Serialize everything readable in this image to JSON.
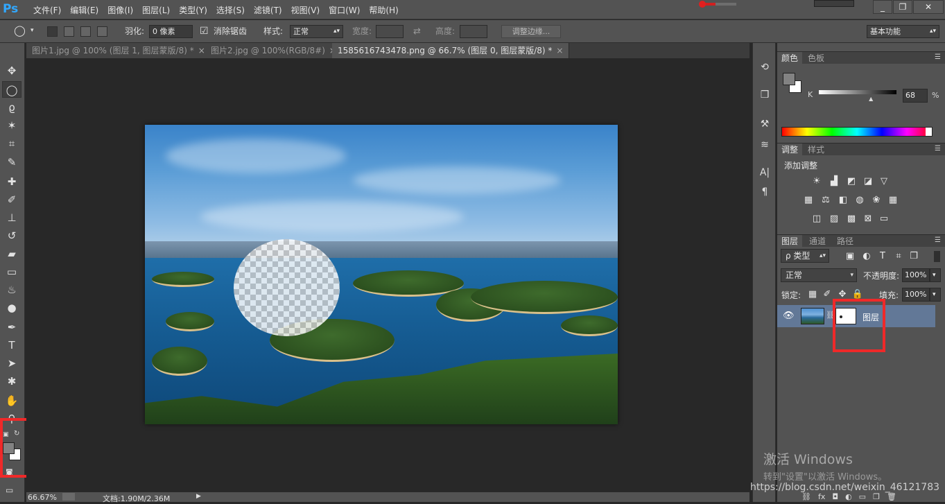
{
  "app": {
    "logo": "Ps"
  },
  "menu": [
    "文件(F)",
    "编辑(E)",
    "图像(I)",
    "图层(L)",
    "类型(Y)",
    "选择(S)",
    "滤镜(T)",
    "视图(V)",
    "窗口(W)",
    "帮助(H)"
  ],
  "window_buttons": [
    "_",
    "❐",
    "✕"
  ],
  "options": {
    "feather_label": "羽化:",
    "feather_value": "0 像素",
    "antialias_label": "消除锯齿",
    "style_label": "样式:",
    "style_value": "正常",
    "width_label": "宽度:",
    "height_label": "高度:",
    "refine_edge": "调整边缘...",
    "workspace": "基本功能"
  },
  "tabs": [
    {
      "label": "图片1.jpg @ 100% (图层 1, 图层蒙版/8) *"
    },
    {
      "label": "图片2.jpg @ 100%(RGB/8#)"
    },
    {
      "label": "1585616743478.png @ 66.7% (图层 0, 图层蒙版/8) *"
    }
  ],
  "status": {
    "zoom": "66.67%",
    "doc": "文档:1.90M/2.36M"
  },
  "color_panel": {
    "tabs": [
      "颜色",
      "色板"
    ],
    "channel": "K",
    "value": "68",
    "unit": "%",
    "slider_level": 0.68
  },
  "adjust_panel": {
    "tabs": [
      "调整",
      "样式"
    ],
    "title": "添加调整"
  },
  "layers_panel": {
    "tabs": [
      "图层",
      "通道",
      "路径"
    ],
    "filter": "ρ 类型",
    "blend_mode": "正常",
    "opacity_label": "不透明度:",
    "opacity_value": "100%",
    "lock_label": "锁定:",
    "fill_label": "填充:",
    "fill_value": "100%",
    "layer_name": "图层"
  },
  "watermark": {
    "line1": "激活 Windows",
    "line2": "转到\"设置\"以激活 Windows。"
  },
  "csdn_url": "https://blog.csdn.net/weixin_46121783",
  "colors": {
    "ui_bg": "#535353",
    "canvas_bg": "#282828",
    "highlight": "#ef2929",
    "layer_selected": "#627897"
  }
}
